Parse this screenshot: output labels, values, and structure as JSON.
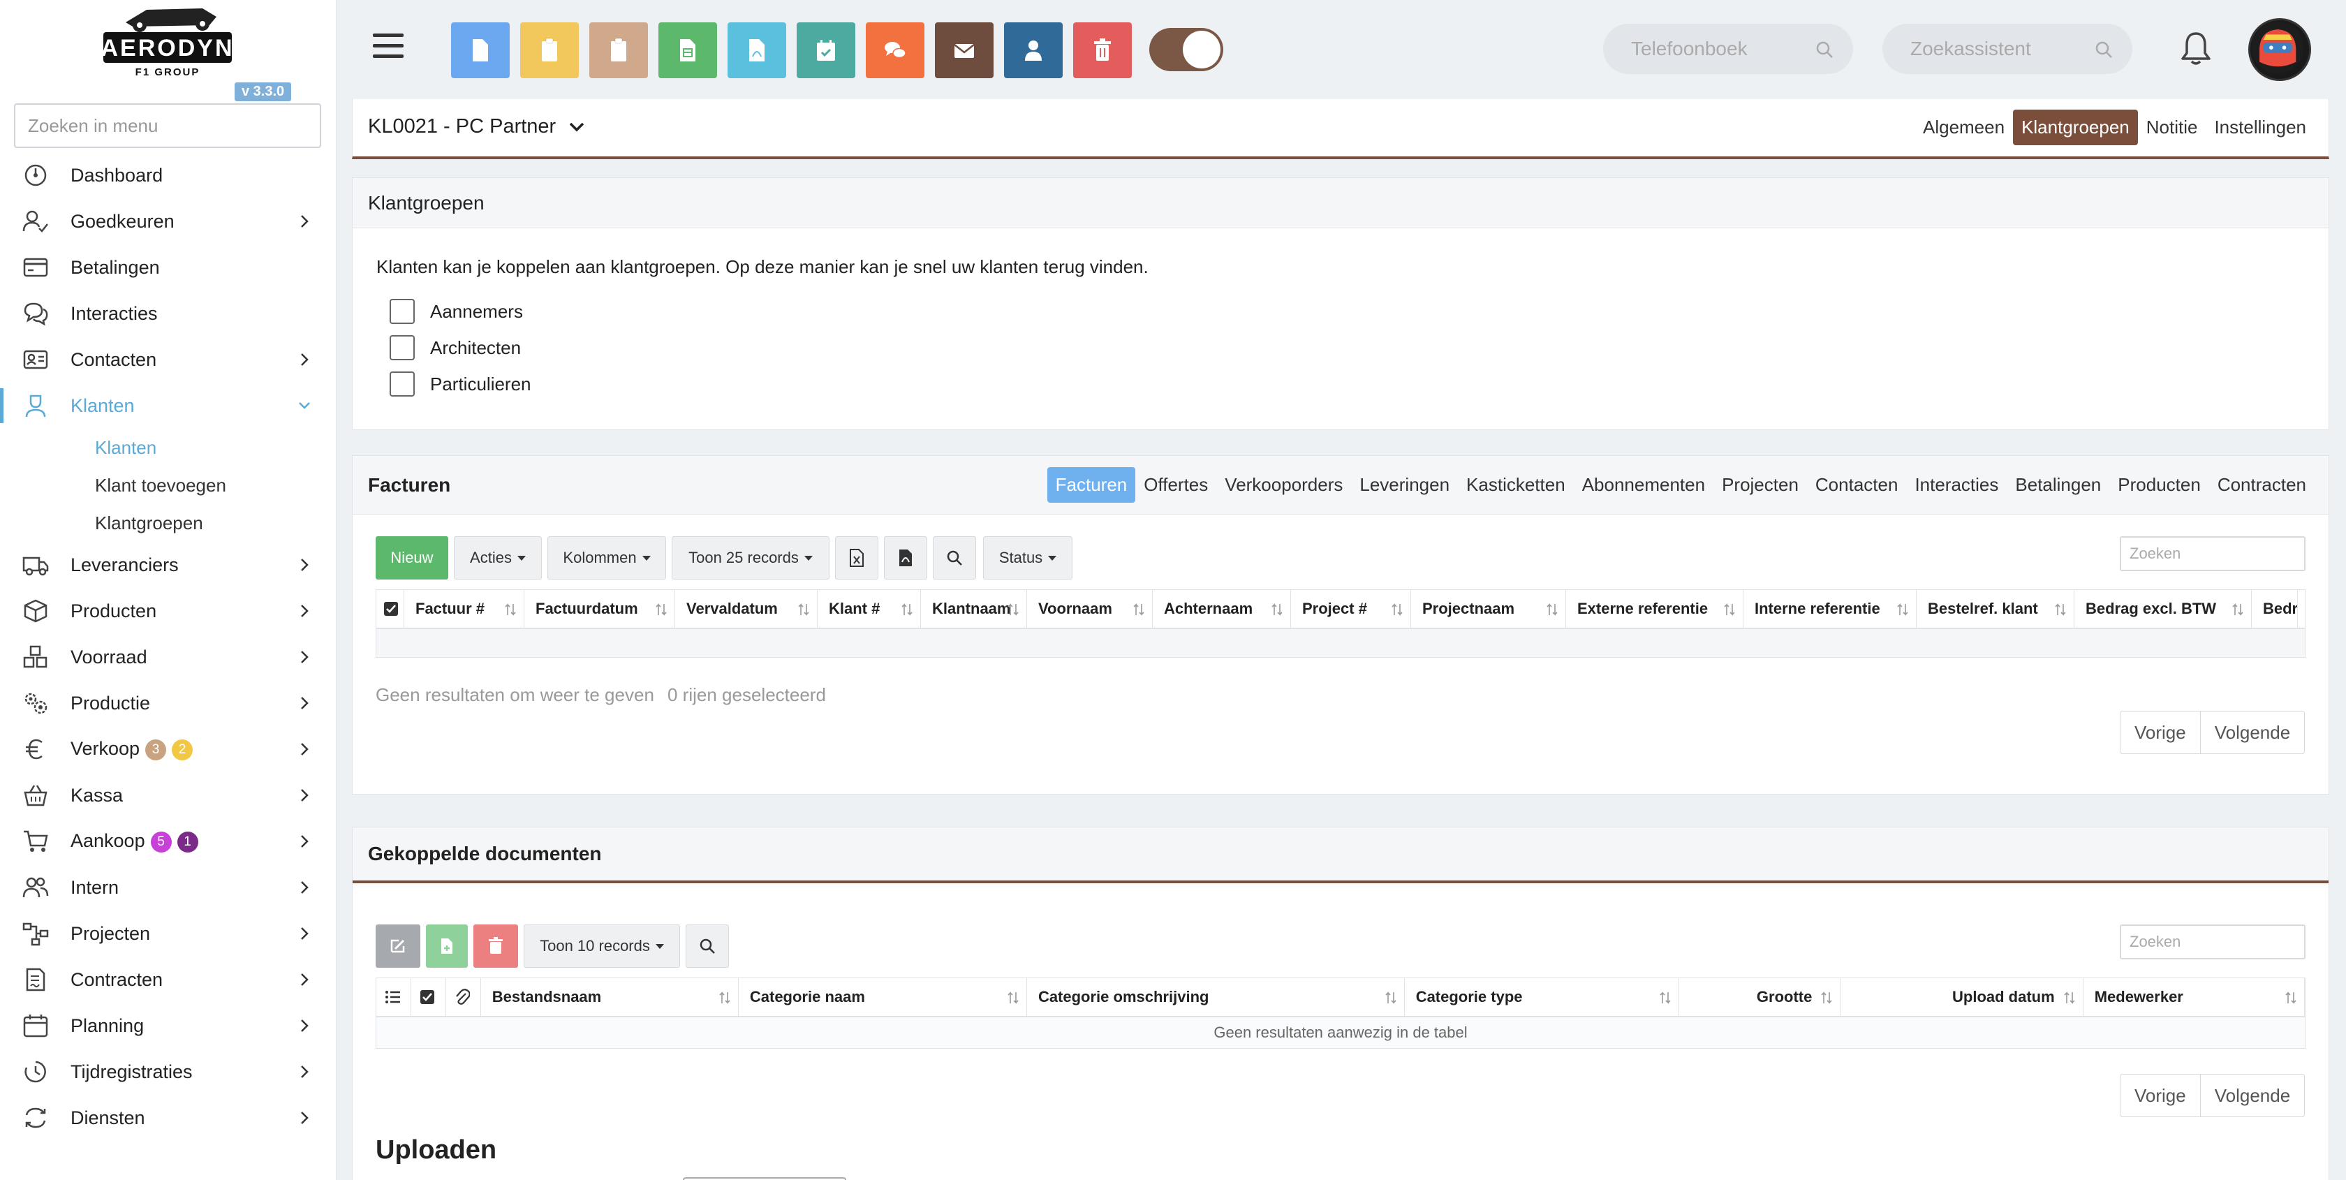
{
  "app": {
    "logo_text": "AERODYN",
    "logo_subtext": "F1 GROUP",
    "version": "v 3.3.0"
  },
  "sidebar": {
    "search_placeholder": "Zoeken in menu",
    "items": [
      {
        "label": "Dashboard",
        "icon": "dashboard-icon"
      },
      {
        "label": "Goedkeuren",
        "icon": "user-check-icon"
      },
      {
        "label": "Betalingen",
        "icon": "credit-card-icon"
      },
      {
        "label": "Interacties",
        "icon": "chat-icon"
      },
      {
        "label": "Contacten",
        "icon": "contact-card-icon"
      },
      {
        "label": "Klanten",
        "icon": "customer-icon"
      },
      {
        "label": "Leveranciers",
        "icon": "truck-icon"
      },
      {
        "label": "Producten",
        "icon": "box-icon"
      },
      {
        "label": "Voorraad",
        "icon": "stock-icon"
      },
      {
        "label": "Productie",
        "icon": "gears-icon"
      },
      {
        "label": "Verkoop",
        "icon": "euro-icon",
        "badges": [
          "3",
          "2"
        ]
      },
      {
        "label": "Kassa",
        "icon": "basket-icon"
      },
      {
        "label": "Aankoop",
        "icon": "cart-icon",
        "badges": [
          "5",
          "1"
        ]
      },
      {
        "label": "Intern",
        "icon": "users-icon"
      },
      {
        "label": "Projecten",
        "icon": "project-icon"
      },
      {
        "label": "Contracten",
        "icon": "contract-icon"
      },
      {
        "label": "Planning",
        "icon": "calendar-icon"
      },
      {
        "label": "Tijdregistraties",
        "icon": "clock-icon"
      },
      {
        "label": "Diensten",
        "icon": "services-icon"
      }
    ],
    "klanten_sub": [
      "Klanten",
      "Klant toevoegen",
      "Klantgroepen"
    ],
    "badge_colors": [
      "#c9a27f",
      "#f2c744",
      "#c741d9",
      "#7b2a8a"
    ]
  },
  "topbar": {
    "phonebook_placeholder": "Telefoonboek",
    "assistant_placeholder": "Zoekassistent",
    "quick_buttons": [
      {
        "name": "new-document-button",
        "color": "#6ba8f0",
        "icon": "file-icon"
      },
      {
        "name": "clipboard-yellow-button",
        "color": "#f2c75c",
        "icon": "clipboard-icon"
      },
      {
        "name": "clipboard-tan-button",
        "color": "#d0a98c",
        "icon": "clipboard-icon"
      },
      {
        "name": "spreadsheet-button",
        "color": "#5cb86a",
        "icon": "spreadsheet-icon"
      },
      {
        "name": "pdf-button",
        "color": "#5bc0de",
        "icon": "pdf-icon"
      },
      {
        "name": "calendar-button",
        "color": "#4caaa0",
        "icon": "calendar-check-icon"
      },
      {
        "name": "chat-button",
        "color": "#f2713f",
        "icon": "chat-bubbles-icon"
      },
      {
        "name": "mail-button",
        "color": "#6e4d3e",
        "icon": "envelope-icon"
      },
      {
        "name": "user-button",
        "color": "#2f6a99",
        "icon": "user-icon"
      },
      {
        "name": "delete-button",
        "color": "#e45d5d",
        "icon": "trash-icon"
      }
    ]
  },
  "header": {
    "title": "KL0021 - PC Partner",
    "tabs": [
      "Algemeen",
      "Klantgroepen",
      "Notitie",
      "Instellingen"
    ],
    "active_tab": "Klantgroepen",
    "accent": "#7a4e3b"
  },
  "klantgroepen": {
    "title": "Klantgroepen",
    "intro": "Klanten kan je koppelen aan klantgroepen. Op deze manier kan je snel uw klanten terug vinden.",
    "groups": [
      "Aannemers",
      "Architecten",
      "Particulieren"
    ]
  },
  "facturen": {
    "title": "Facturen",
    "tabs": [
      "Facturen",
      "Offertes",
      "Verkooporders",
      "Leveringen",
      "Kasticketten",
      "Abonnementen",
      "Projecten",
      "Contacten",
      "Interacties",
      "Betalingen",
      "Producten",
      "Contracten"
    ],
    "new_label": "Nieuw",
    "actions_label": "Acties",
    "columns_label": "Kolommen",
    "show_label": "Toon 25 records",
    "status_label": "Status",
    "search_placeholder": "Zoeken",
    "columns": [
      "Factuur #",
      "Factuurdatum",
      "Vervaldatum",
      "Klant #",
      "Klantnaam",
      "Voornaam",
      "Achternaam",
      "Project #",
      "Projectnaam",
      "Externe referentie",
      "Interne referentie",
      "Bestelref. klant",
      "Bedrag excl. BTW",
      "Bedr"
    ],
    "no_results": "Geen resultaten om weer te geven",
    "selected": "0 rijen geselecteerd",
    "prev": "Vorige",
    "next": "Volgende"
  },
  "documenten": {
    "title": "Gekoppelde documenten",
    "show_label": "Toon 10 records",
    "search_placeholder": "Zoeken",
    "columns": [
      "Bestandsnaam",
      "Categorie naam",
      "Categorie omschrijving",
      "Categorie type",
      "Grootte",
      "Upload datum",
      "Medewerker"
    ],
    "empty": "Geen resultaten aanwezig in de tabel",
    "prev": "Vorige",
    "next": "Volgende",
    "upload_title": "Uploaden"
  }
}
